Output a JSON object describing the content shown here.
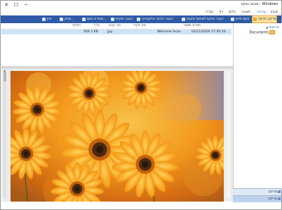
{
  "window": {
    "title": "Windows - מכתב ופקס",
    "min": "─",
    "max": "☐",
    "close": "✕"
  },
  "menu": {
    "items": [
      "קובץ",
      "עריכה",
      "תצוגה",
      "כלים",
      "דף",
      "עזרה"
    ]
  },
  "toolbar": {
    "buttons": [
      {
        "label": "סריקה חדשה",
        "icon": "new-scan-icon"
      },
      {
        "label": "פקס חדש",
        "icon": "new-fax-icon"
      },
      {
        "label": "העבר כפקס לשיתוף מקומי",
        "icon": "forward-as-fax-icon"
      },
      {
        "label": "העבר כדואר אלקטרוני",
        "icon": "forward-email-icon"
      },
      {
        "label": "העבר מקיים",
        "icon": "forward-icon"
      },
      {
        "label": "שמירת בשם...",
        "icon": "save-as-icon"
      },
      {
        "label": "מחק...",
        "icon": "delete-icon"
      },
      {
        "label": "מיין",
        "icon": "sort-icon"
      }
    ]
  },
  "filelist": {
    "columns": [
      "תאריך ושעה",
      "שם מקור",
      "סוג קובץ",
      "גודל",
      "תפקיד"
    ],
    "rows": [
      {
        "datetime": "02/11/2026 17:45:10",
        "source": "Welcome Scan",
        "type": "jpg",
        "size": "504.3 KB",
        "role": ""
      }
    ]
  },
  "tree": {
    "root": "סריקות",
    "child": "Documents"
  },
  "bottom_sections": [
    {
      "label": "סריקה"
    },
    {
      "label": "סריקה"
    }
  ]
}
